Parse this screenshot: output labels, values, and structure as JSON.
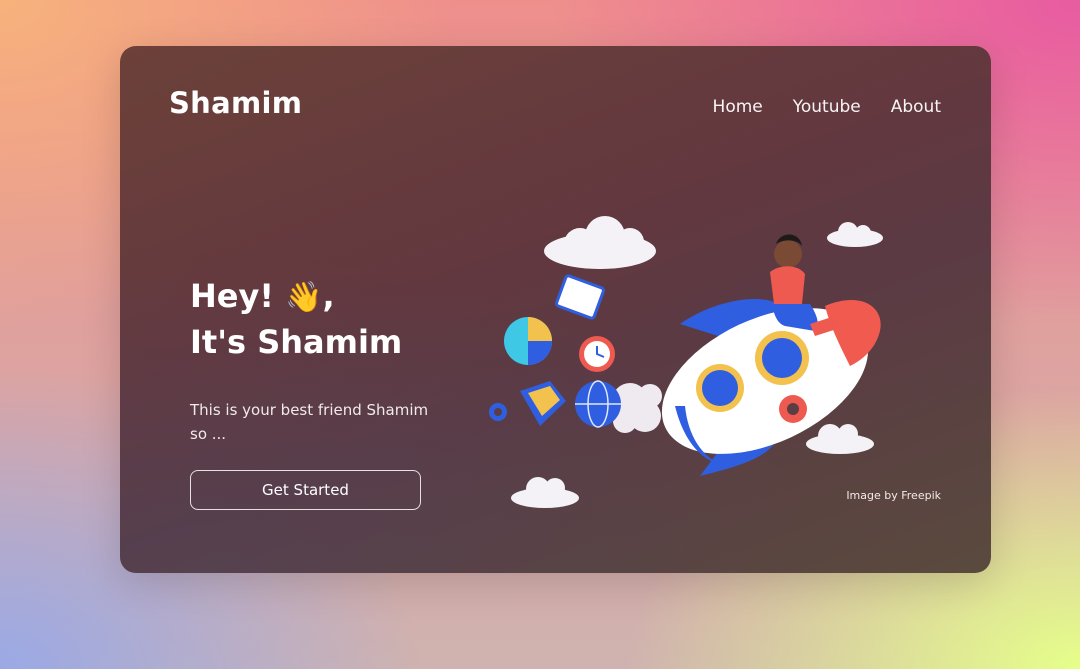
{
  "brand": "Shamim",
  "nav": {
    "items": [
      "Home",
      "Youtube",
      "About"
    ]
  },
  "hero": {
    "line1": "Hey! ",
    "wave_emoji": "👋",
    "line1_suffix": ",",
    "line2": "It's Shamim",
    "description": "This is your best friend Shamim so ...",
    "cta_label": "Get Started"
  },
  "illustration": {
    "credit": "Image by Freepik"
  },
  "colors": {
    "card_bg": "#63383f",
    "text": "#ffffff",
    "rocket_blue": "#2f5fe0",
    "rocket_red": "#f05a4f"
  }
}
